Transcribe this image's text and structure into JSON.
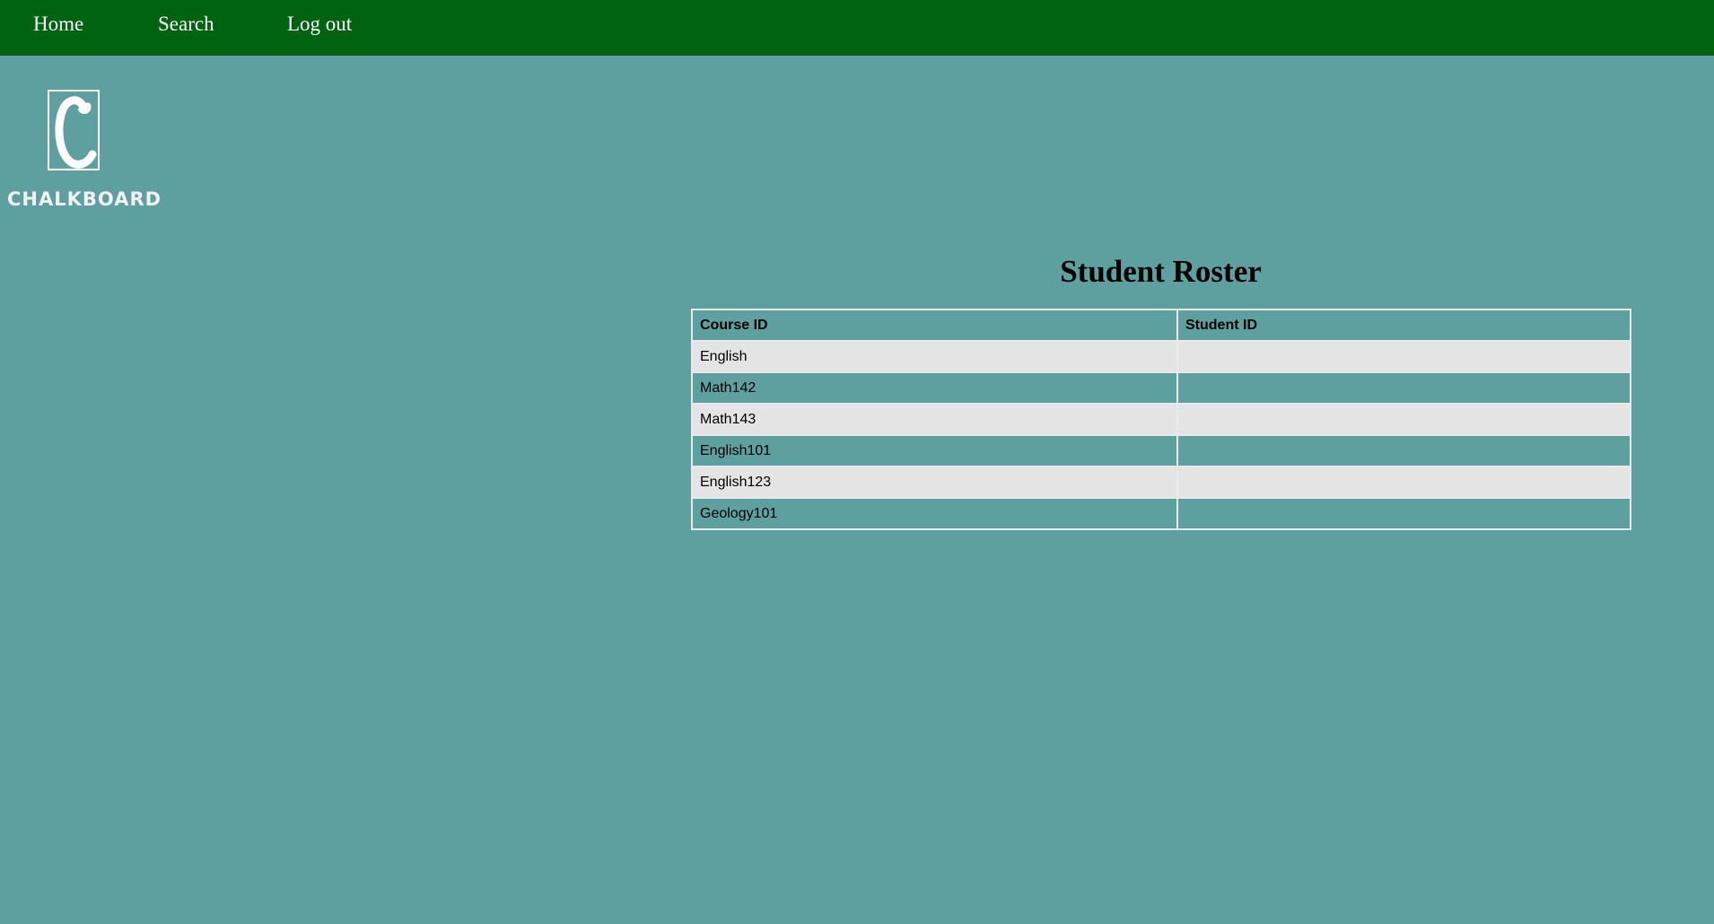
{
  "nav": {
    "home": "Home",
    "search": "Search",
    "logout": "Log out"
  },
  "logo": {
    "letter": "C",
    "word": "CHALKBOARD"
  },
  "page": {
    "title": "Student Roster"
  },
  "table": {
    "columns": [
      "Course ID",
      "Student ID"
    ],
    "rows": [
      {
        "course_id": "English",
        "student_id": ""
      },
      {
        "course_id": "Math142",
        "student_id": ""
      },
      {
        "course_id": "Math143",
        "student_id": ""
      },
      {
        "course_id": "English101",
        "student_id": ""
      },
      {
        "course_id": "English123",
        "student_id": ""
      },
      {
        "course_id": "Geology101",
        "student_id": ""
      }
    ]
  },
  "colors": {
    "nav_bg": "#006311",
    "page_bg": "#5e9fa0",
    "row_alt": "#e4e4e4",
    "border": "#e9e9e9"
  }
}
